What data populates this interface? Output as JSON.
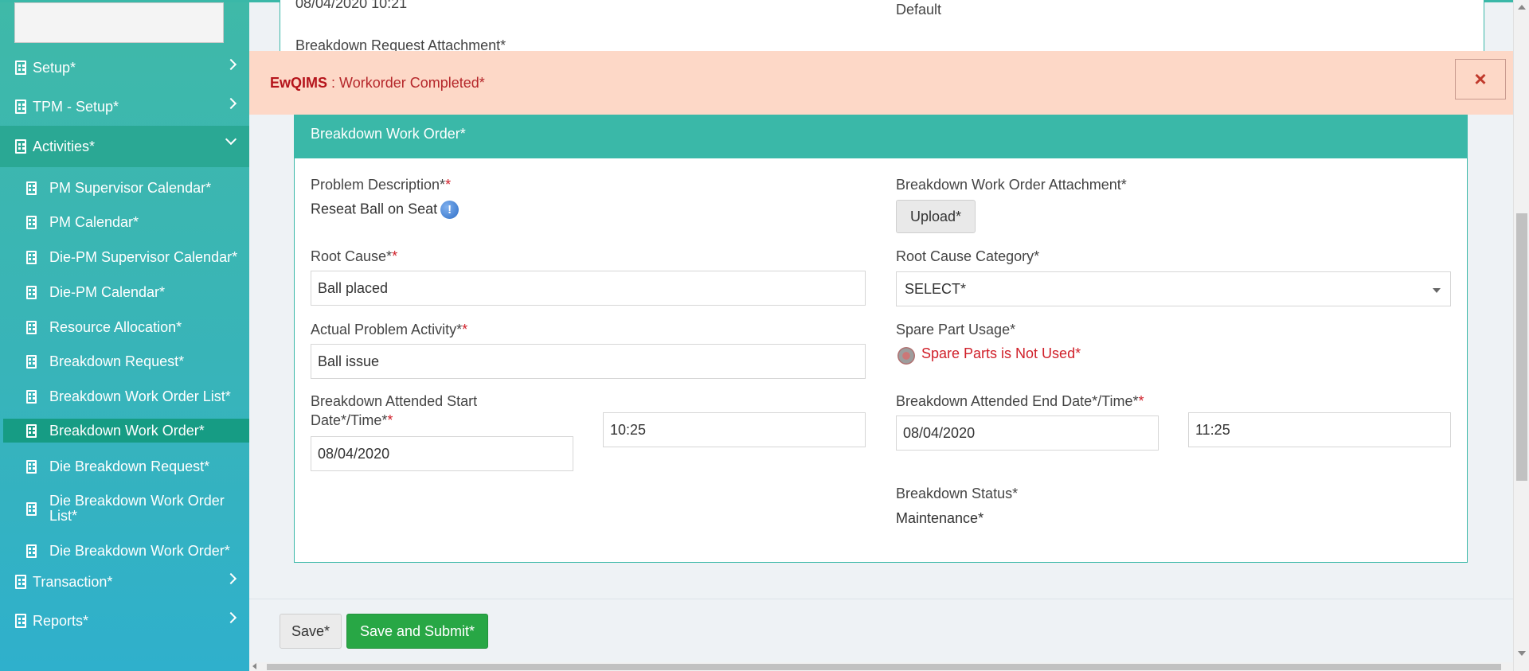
{
  "sidebar": {
    "items": [
      {
        "label": "Setup*"
      },
      {
        "label": "TPM - Setup*"
      },
      {
        "label": "Activities*"
      },
      {
        "label": "Transaction*"
      },
      {
        "label": "Reports*"
      }
    ],
    "activities_sub": [
      {
        "label": "PM Supervisor Calendar*"
      },
      {
        "label": "PM Calendar*"
      },
      {
        "label": "Die-PM Supervisor Calendar*"
      },
      {
        "label": "Die-PM Calendar*"
      },
      {
        "label": "Resource Allocation*"
      },
      {
        "label": "Breakdown Request*"
      },
      {
        "label": "Breakdown Work Order List*"
      },
      {
        "label": "Breakdown Work Order*"
      },
      {
        "label": "Die Breakdown Request*"
      },
      {
        "label": "Die Breakdown Work Order List*"
      },
      {
        "label": "Die Breakdown Work Order*"
      }
    ]
  },
  "previous_panel": {
    "date_text": "08/04/2020 10:21",
    "default_text": "Default",
    "attachment_label": "Breakdown Request Attachment*"
  },
  "alert": {
    "app_name": "EwQIMS",
    "separator": " : ",
    "message": "Workorder Completed*",
    "close_glyph": "×"
  },
  "card": {
    "title": "Breakdown Work Order*",
    "problem_description_label": "Problem Description*",
    "problem_description_value": "Reseat Ball on Seat",
    "attachment_label": "Breakdown Work Order Attachment*",
    "upload_label": "Upload*",
    "root_cause_label": "Root Cause*",
    "root_cause_value": "Ball placed",
    "root_cause_category_label": "Root Cause Category*",
    "root_cause_category_value": "SELECT*",
    "actual_problem_label": "Actual Problem Activity*",
    "actual_problem_value": "Ball issue",
    "spare_part_label": "Spare Part Usage*",
    "spare_part_value": "Spare Parts is Not Used*",
    "start_label_line1": "Breakdown Attended Start",
    "start_label_line2": "Date*/Time*",
    "start_date": "08/04/2020",
    "start_time": "10:25",
    "end_label": "Breakdown Attended End Date*/Time*",
    "end_date": "08/04/2020",
    "end_time": "11:25",
    "status_label": "Breakdown Status*",
    "status_value": "Maintenance*",
    "required_mark": "*",
    "info_glyph": "!"
  },
  "footer": {
    "save_label": "Save*",
    "submit_label": "Save and Submit*"
  },
  "colors": {
    "accent": "#3ab8a8",
    "alert_bg": "#fdd8c7",
    "alert_text": "#b5262a",
    "submit_green": "#28a745",
    "required_red": "#d0202a"
  }
}
